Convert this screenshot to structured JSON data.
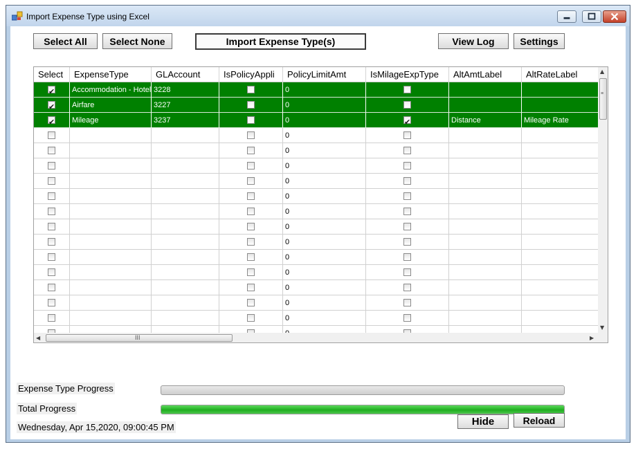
{
  "window": {
    "title": "Import Expense Type using Excel"
  },
  "toolbar": {
    "select_all": "Select All",
    "select_none": "Select None",
    "import": "Import Expense Type(s)",
    "view_log": "View Log",
    "settings": "Settings"
  },
  "grid": {
    "columns": [
      "Select",
      "ExpenseType",
      "GLAccount",
      "IsPolicyAppli",
      "PolicyLimitAmt",
      "IsMilageExpType",
      "AltAmtLabel",
      "AltRateLabel"
    ],
    "rows": [
      {
        "selected": true,
        "expense_type": "Accommodation - Hotel",
        "gl_account": "3228",
        "is_policy": false,
        "policy_limit": "0",
        "is_mileage": false,
        "alt_amt_label": "",
        "alt_rate_label": ""
      },
      {
        "selected": true,
        "expense_type": "Airfare",
        "gl_account": "3227",
        "is_policy": false,
        "policy_limit": "0",
        "is_mileage": false,
        "alt_amt_label": "",
        "alt_rate_label": ""
      },
      {
        "selected": true,
        "expense_type": "Mileage",
        "gl_account": "3237",
        "is_policy": false,
        "policy_limit": "0",
        "is_mileage": true,
        "alt_amt_label": "Distance",
        "alt_rate_label": "Mileage Rate"
      },
      {
        "selected": false,
        "expense_type": "",
        "gl_account": "",
        "is_policy": false,
        "policy_limit": "0",
        "is_mileage": false,
        "alt_amt_label": "",
        "alt_rate_label": ""
      },
      {
        "selected": false,
        "expense_type": "",
        "gl_account": "",
        "is_policy": false,
        "policy_limit": "0",
        "is_mileage": false,
        "alt_amt_label": "",
        "alt_rate_label": ""
      },
      {
        "selected": false,
        "expense_type": "",
        "gl_account": "",
        "is_policy": false,
        "policy_limit": "0",
        "is_mileage": false,
        "alt_amt_label": "",
        "alt_rate_label": ""
      },
      {
        "selected": false,
        "expense_type": "",
        "gl_account": "",
        "is_policy": false,
        "policy_limit": "0",
        "is_mileage": false,
        "alt_amt_label": "",
        "alt_rate_label": ""
      },
      {
        "selected": false,
        "expense_type": "",
        "gl_account": "",
        "is_policy": false,
        "policy_limit": "0",
        "is_mileage": false,
        "alt_amt_label": "",
        "alt_rate_label": ""
      },
      {
        "selected": false,
        "expense_type": "",
        "gl_account": "",
        "is_policy": false,
        "policy_limit": "0",
        "is_mileage": false,
        "alt_amt_label": "",
        "alt_rate_label": ""
      },
      {
        "selected": false,
        "expense_type": "",
        "gl_account": "",
        "is_policy": false,
        "policy_limit": "0",
        "is_mileage": false,
        "alt_amt_label": "",
        "alt_rate_label": ""
      },
      {
        "selected": false,
        "expense_type": "",
        "gl_account": "",
        "is_policy": false,
        "policy_limit": "0",
        "is_mileage": false,
        "alt_amt_label": "",
        "alt_rate_label": ""
      },
      {
        "selected": false,
        "expense_type": "",
        "gl_account": "",
        "is_policy": false,
        "policy_limit": "0",
        "is_mileage": false,
        "alt_amt_label": "",
        "alt_rate_label": ""
      },
      {
        "selected": false,
        "expense_type": "",
        "gl_account": "",
        "is_policy": false,
        "policy_limit": "0",
        "is_mileage": false,
        "alt_amt_label": "",
        "alt_rate_label": ""
      },
      {
        "selected": false,
        "expense_type": "",
        "gl_account": "",
        "is_policy": false,
        "policy_limit": "0",
        "is_mileage": false,
        "alt_amt_label": "",
        "alt_rate_label": ""
      },
      {
        "selected": false,
        "expense_type": "",
        "gl_account": "",
        "is_policy": false,
        "policy_limit": "0",
        "is_mileage": false,
        "alt_amt_label": "",
        "alt_rate_label": ""
      },
      {
        "selected": false,
        "expense_type": "",
        "gl_account": "",
        "is_policy": false,
        "policy_limit": "0",
        "is_mileage": false,
        "alt_amt_label": "",
        "alt_rate_label": ""
      },
      {
        "selected": false,
        "expense_type": "",
        "gl_account": "",
        "is_policy": false,
        "policy_limit": "0",
        "is_mileage": false,
        "alt_amt_label": "",
        "alt_rate_label": ""
      }
    ],
    "hscroll_grip": "III"
  },
  "progress": {
    "expense_type_label": "Expense Type Progress",
    "expense_type_value": 0,
    "total_label": "Total Progress",
    "total_value": 100
  },
  "status": {
    "datetime": "Wednesday, Apr 15,2020, 09:00:45 PM"
  },
  "footer": {
    "hide": "Hide",
    "reload": "Reload"
  },
  "colors": {
    "selected_row": "#008000",
    "progress_fill": "#1fae1f"
  },
  "icons": [
    "app-icon",
    "minimize-icon",
    "maximize-icon",
    "close-icon",
    "scroll-up-icon",
    "scroll-down-icon",
    "scroll-left-icon",
    "scroll-right-icon"
  ]
}
